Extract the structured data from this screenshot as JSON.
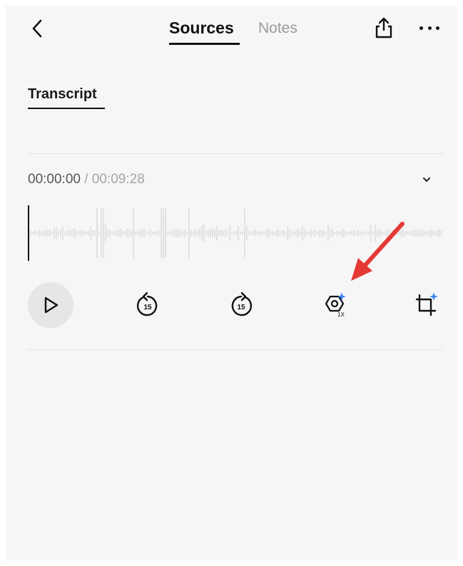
{
  "header": {
    "tabs": [
      {
        "label": "Sources",
        "active": true
      },
      {
        "label": "Notes",
        "active": false
      }
    ],
    "icons": {
      "back": "chevron-left-icon",
      "share": "share-icon",
      "more": "more-horizontal-icon"
    }
  },
  "content": {
    "subtab": "Transcript"
  },
  "player": {
    "current_time": "00:00:00",
    "separator": " / ",
    "total_time": "00:09:28",
    "progress": 0,
    "controls": {
      "play": "play-icon",
      "rewind": "rewind-15-icon",
      "forward": "forward-15-icon",
      "speed_label": "1X",
      "crop": "crop-ai-icon"
    }
  },
  "colors": {
    "background": "#f6f6f6",
    "text": "#111111",
    "muted": "#a5a5a5",
    "ai_accent": "#3b82f6",
    "annotation_arrow": "#e53935"
  }
}
